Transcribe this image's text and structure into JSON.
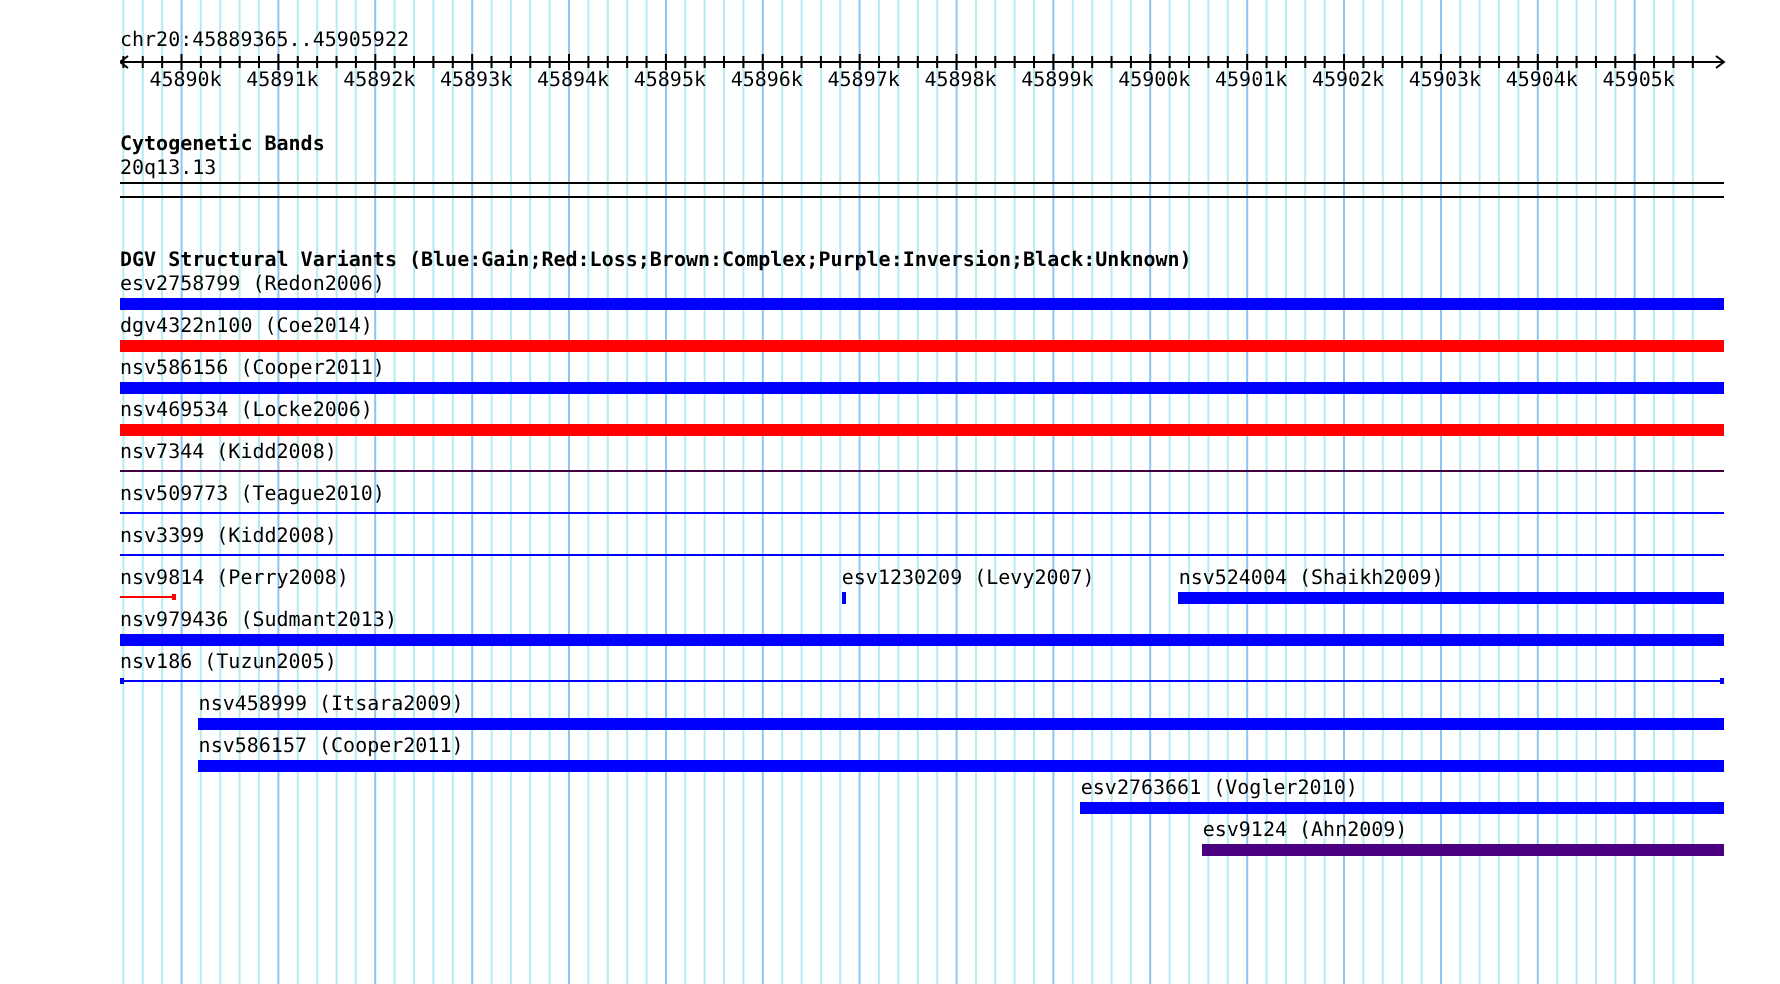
{
  "ruler": {
    "title": "chr20:45889365..45905922",
    "ticks": [
      "45890k",
      "45891k",
      "45892k",
      "45893k",
      "45894k",
      "45895k",
      "45896k",
      "45897k",
      "45898k",
      "45899k",
      "45900k",
      "45901k",
      "45902k",
      "45903k",
      "45904k",
      "45905k"
    ]
  },
  "cytoband_track": {
    "title": "Cytogenetic Bands",
    "band": "20q13.13"
  },
  "variant_track": {
    "title": "DGV Structural Variants (Blue:Gain;Red:Loss;Brown:Complex;Purple:Inversion;Black:Unknown)",
    "rows": [
      {
        "features": [
          {
            "label": "esv2758799 (Redon2006)",
            "color": "#0000ff",
            "kind": "thick"
          }
        ]
      },
      {
        "features": [
          {
            "label": "dgv4322n100 (Coe2014)",
            "color": "#ff0000",
            "kind": "thick"
          }
        ]
      },
      {
        "features": [
          {
            "label": "nsv586156 (Cooper2011)",
            "color": "#0000ff",
            "kind": "thick"
          }
        ]
      },
      {
        "features": [
          {
            "label": "nsv469534 (Locke2006)",
            "color": "#ff0000",
            "kind": "thick"
          }
        ]
      },
      {
        "features": [
          {
            "label": "nsv7344 (Kidd2008)",
            "color": "#400040",
            "kind": "thin"
          }
        ]
      },
      {
        "features": [
          {
            "label": "nsv509773 (Teague2010)",
            "color": "#0000ff",
            "kind": "thin"
          }
        ]
      },
      {
        "features": [
          {
            "label": "nsv3399 (Kidd2008)",
            "color": "#0000ff",
            "kind": "thin"
          }
        ]
      },
      {
        "features": [
          {
            "label": "nsv9814 (Perry2008)",
            "color": "#ff0000",
            "kind": "thin"
          },
          {
            "label": "esv1230209 (Levy2007)",
            "color": "#0000ff",
            "kind": "thick"
          },
          {
            "label": "nsv524004 (Shaikh2009)",
            "color": "#0000ff",
            "kind": "thick"
          }
        ]
      },
      {
        "features": [
          {
            "label": "nsv979436 (Sudmant2013)",
            "color": "#0000ff",
            "kind": "thick"
          }
        ]
      },
      {
        "features": [
          {
            "label": "nsv186 (Tuzun2005)",
            "color": "#0000ff",
            "kind": "thin"
          }
        ]
      },
      {
        "features": [
          {
            "label": "nsv458999 (Itsara2009)",
            "color": "#0000ff",
            "kind": "thick"
          }
        ]
      },
      {
        "features": [
          {
            "label": "nsv586157 (Cooper2011)",
            "color": "#0000ff",
            "kind": "thick"
          }
        ]
      },
      {
        "features": [
          {
            "label": "esv2763661 (Vogler2010)",
            "color": "#0000ff",
            "kind": "thick"
          }
        ]
      },
      {
        "features": [
          {
            "label": "esv9124 (Ahn2009)",
            "color": "#4b0082",
            "kind": "thick"
          }
        ]
      }
    ]
  }
}
